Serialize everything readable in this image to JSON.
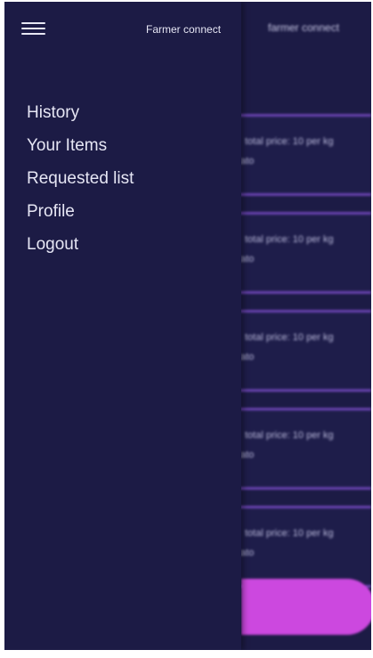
{
  "header": {
    "title": "Farmer connect",
    "menu_icon": "hamburger-menu-icon"
  },
  "drawer": {
    "items": [
      {
        "label": "History"
      },
      {
        "label": "Your Items"
      },
      {
        "label": "Requested list"
      },
      {
        "label": "Profile"
      },
      {
        "label": "Logout"
      }
    ]
  },
  "background": {
    "title": "farmer connect",
    "cards": [
      {
        "price": "total price: 10 per kg",
        "item": "tato"
      },
      {
        "price": "total price: 10 per kg",
        "item": "tato"
      },
      {
        "price": "total price: 10 per kg",
        "item": "tato"
      },
      {
        "price": "total price: 10 per kg",
        "item": "tato"
      },
      {
        "price": "total price: 10 per kg",
        "item": "tato"
      }
    ]
  },
  "colors": {
    "background": "#1c1b45",
    "card_border": "#6a43b0",
    "accent": "#cc48df",
    "text": "#e6e6f4"
  }
}
